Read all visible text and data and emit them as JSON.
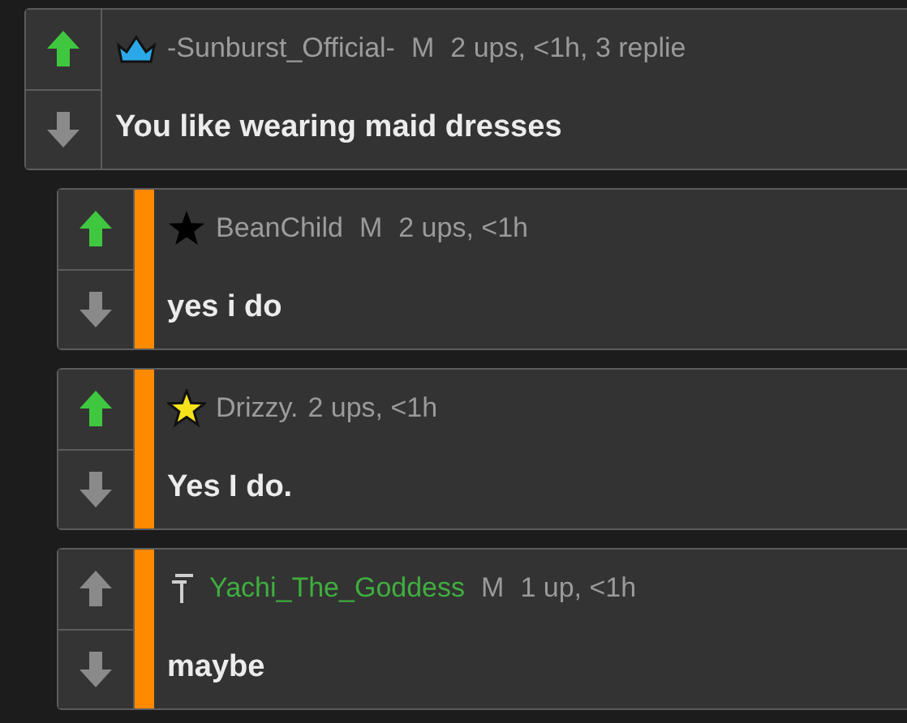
{
  "comments": [
    {
      "kind": "post",
      "upvoted": true,
      "badge": {
        "kind": "crown"
      },
      "username": "-Sunburst_Official-",
      "color": "#9c9c9c",
      "mod": "M",
      "meta": "2 ups, <1h, 3 replie",
      "text": "You like wearing maid dresses"
    },
    {
      "kind": "reply",
      "upvoted": true,
      "badge": {
        "kind": "black-star"
      },
      "username": "BeanChild",
      "color": "#9c9c9c",
      "mod": "M",
      "meta": "2 ups, <1h",
      "text": "yes i do"
    },
    {
      "kind": "reply",
      "upvoted": true,
      "badge": {
        "kind": "yellow-star"
      },
      "username": "Drizzy.",
      "color": "#9c9c9c",
      "meta": "2 ups, <1h",
      "text": "Yes I do."
    },
    {
      "kind": "reply",
      "upvoted": false,
      "badge": {
        "kind": "pin"
      },
      "username": "Yachi_The_Goddess",
      "color": "#3fae3f",
      "mod": "M",
      "meta": "1 up, <1h",
      "text": "maybe"
    }
  ]
}
